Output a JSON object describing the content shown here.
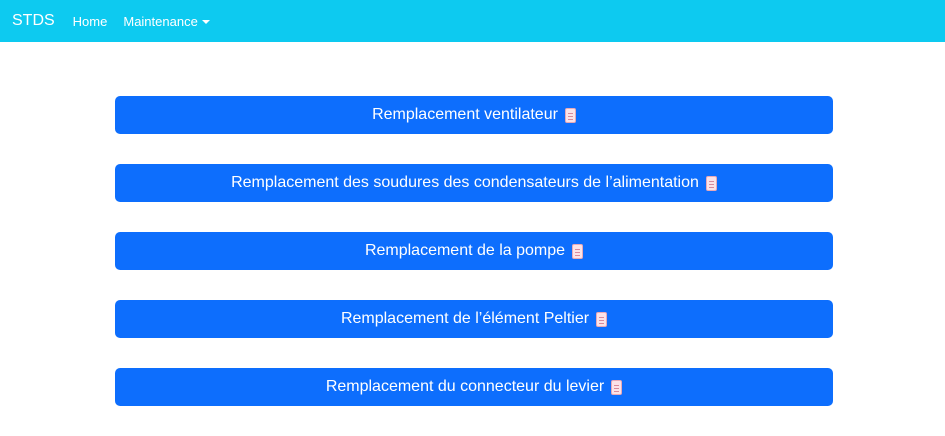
{
  "navbar": {
    "brand": "STDS",
    "home": "Home",
    "maintenance": "Maintenance",
    "background": "#0dcaf0"
  },
  "buttons": [
    {
      "label": "Remplacement ventilateur",
      "icon": "document-icon"
    },
    {
      "label": "Remplacement des soudures des condensateurs de l’alimentation",
      "icon": "document-icon"
    },
    {
      "label": "Remplacement de la pompe",
      "icon": "document-icon"
    },
    {
      "label": "Remplacement de l’élément Peltier",
      "icon": "document-icon"
    },
    {
      "label": "Remplacement du connecteur du levier",
      "icon": "document-icon"
    }
  ],
  "colors": {
    "button": "#0d6efd",
    "text": "#ffffff"
  }
}
